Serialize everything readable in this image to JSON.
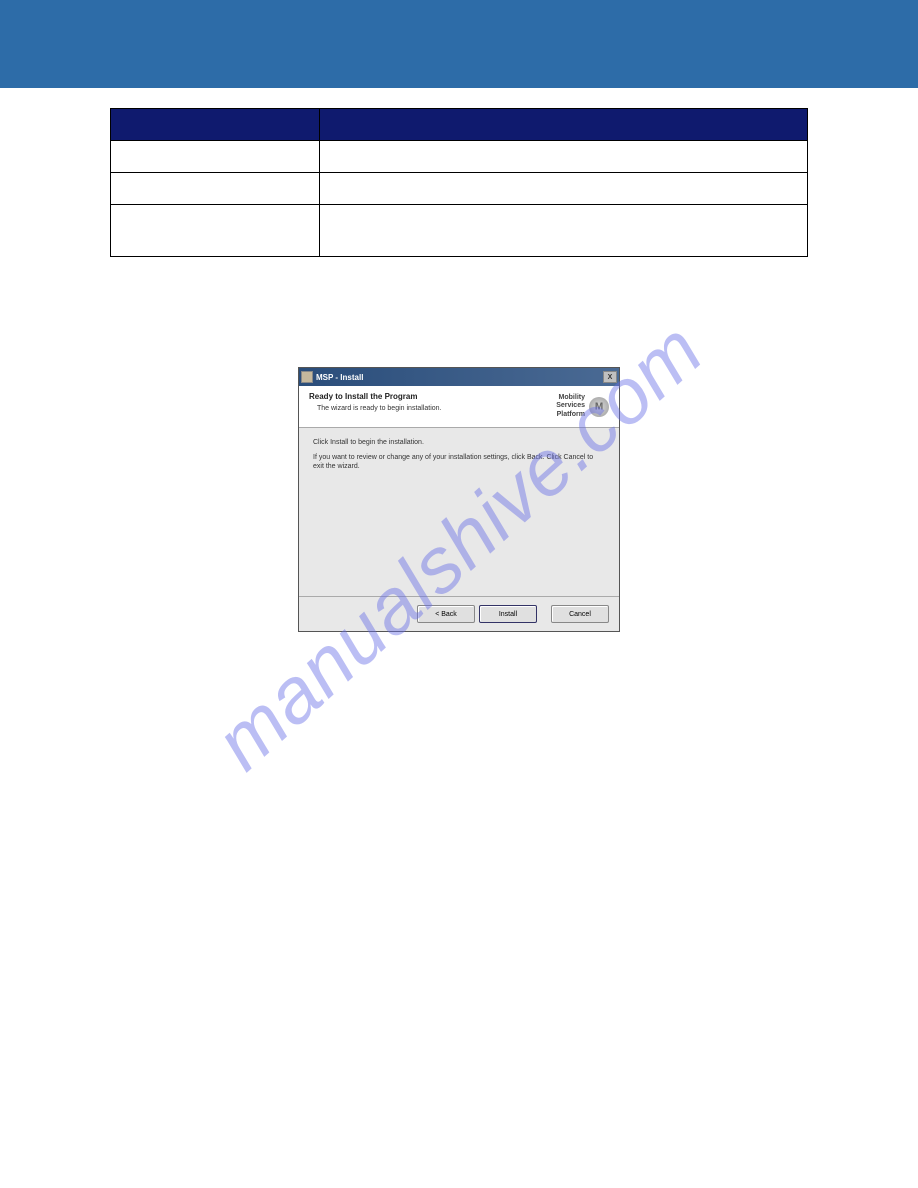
{
  "table": {
    "headers": [
      "",
      ""
    ],
    "rows": [
      [
        "",
        ""
      ],
      [
        "",
        ""
      ],
      [
        "",
        ""
      ]
    ]
  },
  "installer": {
    "titlebar": "MSP - Install",
    "close_label": "X",
    "header_title": "Ready to Install the Program",
    "header_subtitle": "The wizard is ready to begin installation.",
    "brand_line1": "Mobility",
    "brand_line2": "Services",
    "brand_line3": "Platform",
    "body_line1": "Click Install to begin the installation.",
    "body_line2": "If you want to review or change any of your installation settings, click Back. Click Cancel to exit the wizard.",
    "back_button": "< Back",
    "install_button": "Install",
    "cancel_button": "Cancel"
  },
  "watermark": "manualshive.com"
}
